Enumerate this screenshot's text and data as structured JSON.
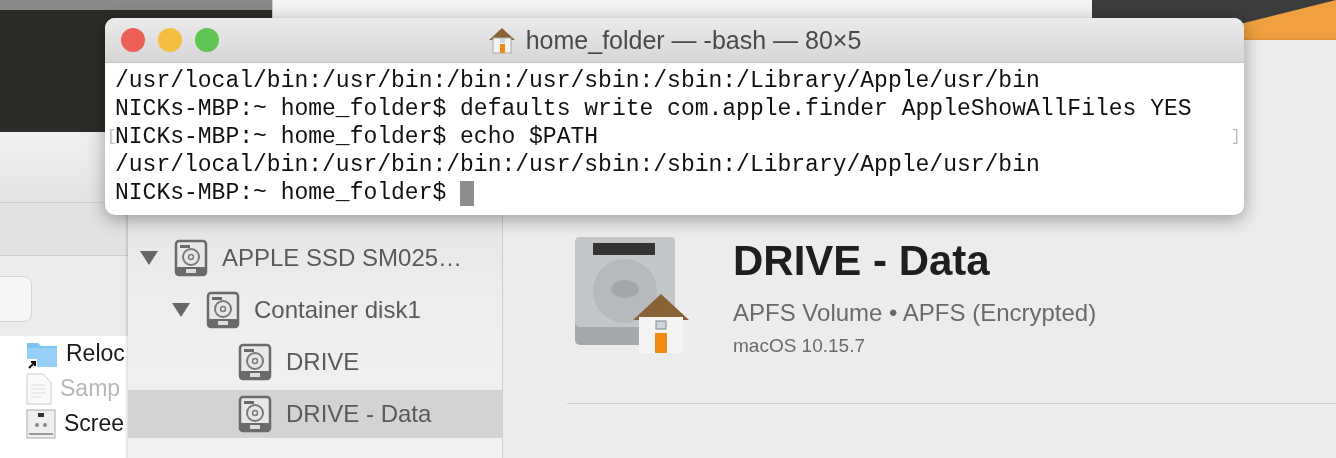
{
  "terminal": {
    "title": "home_folder — -bash — 80×5",
    "lines": [
      {
        "text": "/usr/local/bin:/usr/bin:/bin:/usr/sbin:/sbin:/Library/Apple/usr/bin"
      },
      {
        "text": "NICKs-MBP:~ home_folder$ defaults write com.apple.finder AppleShowAllFiles YES"
      },
      {
        "text": "NICKs-MBP:~ home_folder$ echo $PATH",
        "mark_left": "[",
        "mark_right": "]"
      },
      {
        "text": "/usr/local/bin:/usr/bin:/bin:/usr/sbin:/sbin:/Library/Apple/usr/bin"
      },
      {
        "text": "NICKs-MBP:~ home_folder$",
        "cursor": true
      }
    ]
  },
  "finder": {
    "files": [
      {
        "name": "Reloc",
        "kind": "alias-folder",
        "dimmed": false
      },
      {
        "name": "Samp",
        "kind": "document",
        "dimmed": true
      },
      {
        "name": "Scree",
        "kind": "screenshot",
        "dimmed": false
      }
    ]
  },
  "disk_utility": {
    "sidebar": {
      "items": [
        {
          "label": "APPLE SSD SM025…",
          "expanded": true,
          "selected": false,
          "children": [
            {
              "label": "Container disk1",
              "expanded": true,
              "selected": false,
              "children": [
                {
                  "label": "DRIVE",
                  "selected": false
                },
                {
                  "label": "DRIVE - Data",
                  "selected": true
                }
              ]
            }
          ]
        }
      ]
    },
    "volume": {
      "name": "DRIVE - Data",
      "description": "APFS Volume • APFS (Encrypted)",
      "os": "macOS 10.15.7"
    }
  }
}
